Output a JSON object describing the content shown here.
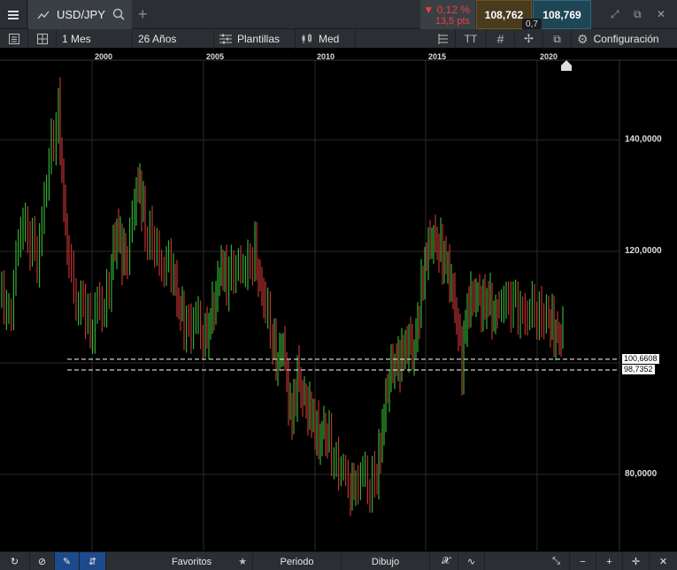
{
  "header": {
    "symbol": "USD/JPY",
    "change_pct": "▼ 0,12 %",
    "change_pts": "13,5 pts",
    "bid": "108,762",
    "ask": "108,769",
    "spread": "0,7"
  },
  "toolbar": {
    "interval": "1 Mes",
    "range": "26 Años",
    "templates": "Plantillas",
    "chart_type": "Med",
    "settings": "Configuración"
  },
  "chart_data": {
    "type": "candlestick",
    "y_ticks": [
      "140,0000",
      "120,0000",
      "80,0000"
    ],
    "x_ticks": [
      "2000",
      "2005",
      "2010",
      "2015",
      "2020"
    ],
    "ylim": [
      72,
      160
    ],
    "horizontal_lines": [
      {
        "value": 100.6608,
        "label": "100,6608"
      },
      {
        "value": 98.7352,
        "label": "98,7352"
      }
    ],
    "colors": {
      "up": "#3ccf3c",
      "down": "#e23b3b"
    },
    "grid": true
  },
  "bottom": {
    "favorites": "Favoritos",
    "period": "Periodo",
    "drawing": "Dibujo"
  }
}
